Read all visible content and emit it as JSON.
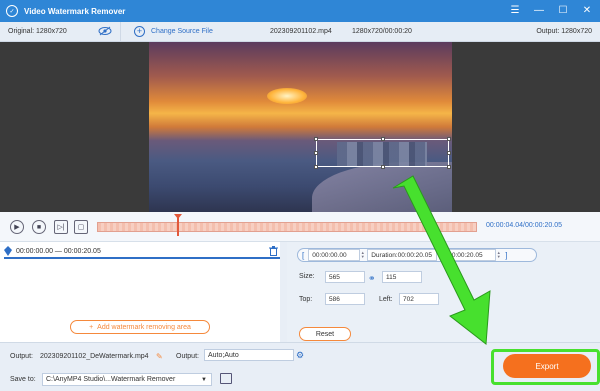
{
  "app": {
    "title": "Video Watermark Remover"
  },
  "info": {
    "original": "Original: 1280x720",
    "change_source": "Change Source File",
    "filename": "202309201102.mp4",
    "res_duration": "1280x720/00:00:20",
    "output": "Output: 1280x720"
  },
  "timeline": {
    "current": "00:00:04.04/",
    "total": "00:00:20.05"
  },
  "segment": {
    "range": "00:00:00.00 — 00:00:20.05"
  },
  "panel": {
    "start": "00:00:00.00",
    "duration_label": "Duration:00:00:20.05",
    "end": "00:00:20.05",
    "size_label": "Size:",
    "width": "565",
    "height": "115",
    "top_label": "Top:",
    "top": "586",
    "left_label": "Left:",
    "left": "702",
    "reset": "Reset"
  },
  "add_area": "Add watermark removing area",
  "bottom": {
    "output_label": "Output:",
    "output_file": "202309201102_DeWatermark.mp4",
    "output2_label": "Output:",
    "output_format": "Auto;Auto",
    "save_label": "Save to:",
    "save_path": "C:\\AnyMP4 Studio\\...Watermark Remover",
    "export": "Export"
  },
  "colors": {
    "titlebar": "#2f86d6",
    "accent": "#f5701e",
    "highlight": "#47e02e"
  }
}
